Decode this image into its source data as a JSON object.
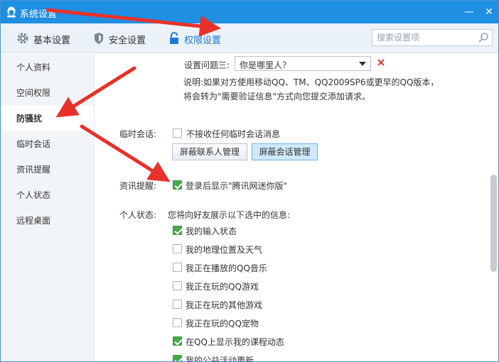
{
  "window": {
    "title": "系统设置",
    "minimize_glyph": "—",
    "close_glyph": "✕",
    "accent_color": "#1e8fe3"
  },
  "toolbar": {
    "tabs": [
      {
        "label": "基本设置",
        "icon": "gear-icon"
      },
      {
        "label": "安全设置",
        "icon": "shield-icon"
      },
      {
        "label": "权限设置",
        "icon": "lock-icon",
        "active": true
      }
    ],
    "search": {
      "placeholder": "搜索设置项",
      "value": ""
    }
  },
  "sidebar": {
    "items": [
      {
        "label": "个人资料"
      },
      {
        "label": "空间权限"
      },
      {
        "label": "防骚扰",
        "active": true
      },
      {
        "label": "临时会话"
      },
      {
        "label": "资讯提醒"
      },
      {
        "label": "个人状态"
      },
      {
        "label": "远程桌面"
      }
    ]
  },
  "main": {
    "question3": {
      "label": "设置问题三:",
      "selected": "你是哪里人？"
    },
    "note": "说明:如果对方使用移动QQ、TM、QQ2009SP6或更早的QQ版本，将会转为\"需要验证信息\"方式向您提交添加请求。",
    "temp_session": {
      "label": "临时会话:",
      "checkbox": {
        "label": "不接收任何临时会话消息",
        "checked": false
      },
      "buttons": [
        "屏蔽联系人管理",
        "屏蔽会话管理"
      ]
    },
    "news": {
      "label": "资讯提醒:",
      "checkbox": {
        "label": "登录后显示\"腾讯网迷你版\"",
        "checked": true
      }
    },
    "status": {
      "label": "个人状态:",
      "intro": "您将向好友展示以下选中的信息:",
      "options": [
        {
          "label": "我的输入状态",
          "checked": true
        },
        {
          "label": "我的地理位置及天气",
          "checked": false
        },
        {
          "label": "我正在播放的QQ音乐",
          "checked": false
        },
        {
          "label": "我正在玩的QQ游戏",
          "checked": false
        },
        {
          "label": "我正在玩的其他游戏",
          "checked": false
        },
        {
          "label": "我正在玩的QQ宠物",
          "checked": false
        },
        {
          "label": "在QQ上显示我的课程动态",
          "checked": true
        },
        {
          "label": "我的公益活动更新",
          "checked": true
        }
      ]
    }
  },
  "annotation_color": "#e8312a"
}
